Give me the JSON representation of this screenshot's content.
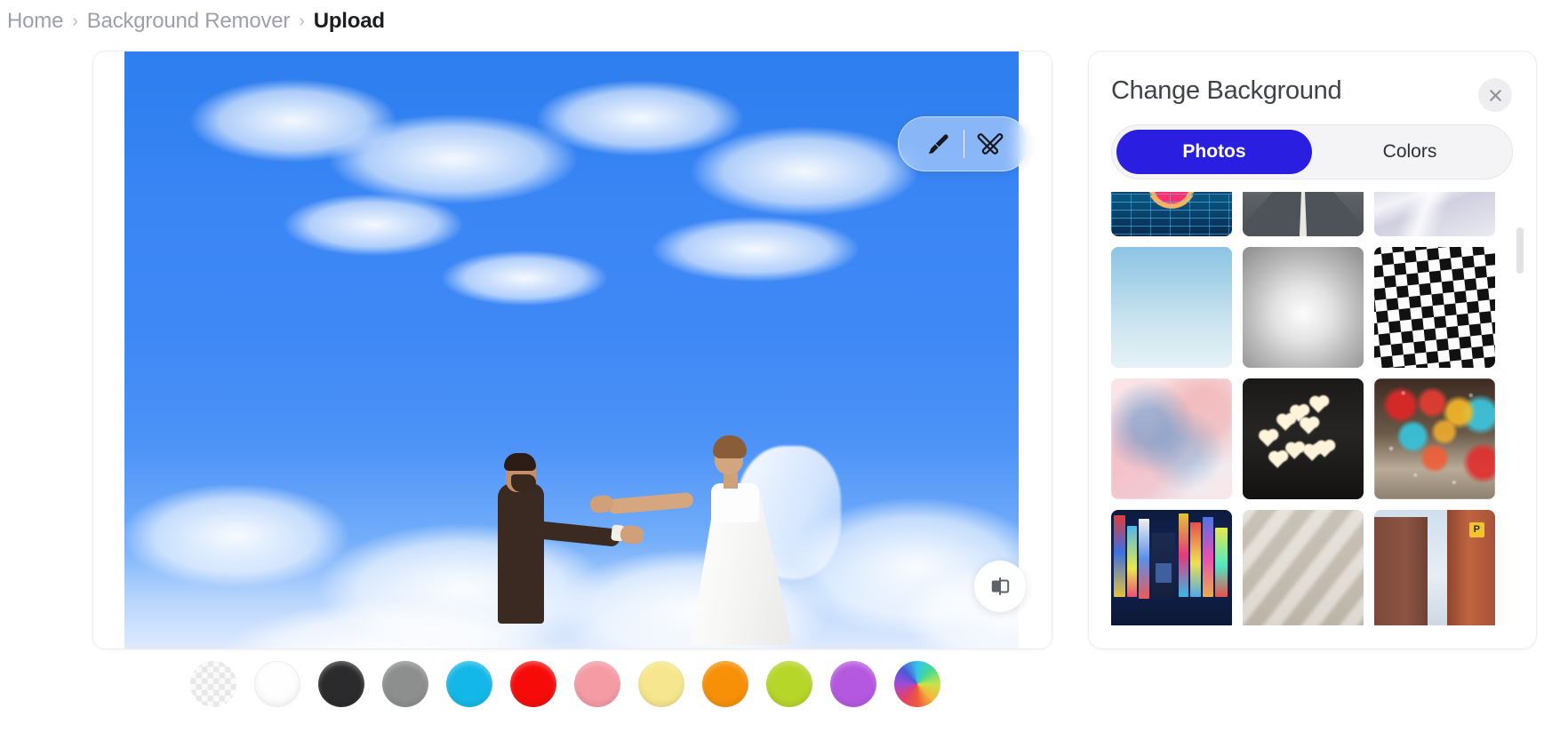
{
  "breadcrumb": {
    "items": [
      {
        "label": "Home",
        "current": false
      },
      {
        "label": "Background Remover",
        "current": false
      },
      {
        "label": "Upload",
        "current": true
      }
    ],
    "separator": "›"
  },
  "editor": {
    "photo_description": "Wedding couple holding hands against a blue sky with white clouds",
    "toolbar": {
      "brush_tool": "brush-tool",
      "erase_restore_tool": "magic-erase-tool"
    },
    "compare_button_label": "compare-before-after"
  },
  "panel": {
    "title": "Change Background",
    "close_label": "×",
    "tabs": [
      {
        "label": "Photos",
        "active": true
      },
      {
        "label": "Colors",
        "active": false
      }
    ],
    "thumbnails": [
      {
        "name": "synthwave-retro-grid",
        "style": "t-synthwave"
      },
      {
        "name": "desert-highway-road",
        "style": "t-road"
      },
      {
        "name": "white-silk-fabric",
        "style": "t-fabric"
      },
      {
        "name": "clear-blue-sky-gradient",
        "style": "t-bluesky"
      },
      {
        "name": "gray-radial-gradient",
        "style": "t-graygrad"
      },
      {
        "name": "warped-checkerboard",
        "style": "t-checker"
      },
      {
        "name": "pink-blue-watercolor-clouds",
        "style": "t-watercolor"
      },
      {
        "name": "heart-shaped-bokeh-night",
        "style": "t-hearts"
      },
      {
        "name": "colorful-bokeh-rainy-window",
        "style": "t-bokeh"
      },
      {
        "name": "tokyo-neon-street",
        "style": "t-tokyo"
      },
      {
        "name": "beige-wall-diagonal-shadows",
        "style": "t-wall"
      },
      {
        "name": "brick-buildings-parking-sign",
        "style": "t-brick"
      }
    ],
    "brick_sign_text": "P"
  },
  "swatches": [
    {
      "name": "transparent",
      "color": "transparent",
      "kind": "transparent"
    },
    {
      "name": "white",
      "color": "#ffffff",
      "kind": "white"
    },
    {
      "name": "charcoal",
      "color": "#2b2b2d",
      "kind": "solid"
    },
    {
      "name": "gray",
      "color": "#8d8f8e",
      "kind": "solid"
    },
    {
      "name": "cyan",
      "color": "#14b8e8",
      "kind": "solid"
    },
    {
      "name": "red",
      "color": "#f60b09",
      "kind": "solid"
    },
    {
      "name": "pink",
      "color": "#f59ba4",
      "kind": "solid"
    },
    {
      "name": "light-yellow",
      "color": "#f6e78e",
      "kind": "solid"
    },
    {
      "name": "orange",
      "color": "#f79007",
      "kind": "solid"
    },
    {
      "name": "yellow-green",
      "color": "#b7d62a",
      "kind": "solid"
    },
    {
      "name": "purple",
      "color": "#b558e0",
      "kind": "solid"
    },
    {
      "name": "color-picker",
      "color": "rainbow",
      "kind": "rainbow"
    }
  ],
  "colors": {
    "accent_blue": "#2a1fe0",
    "breadcrumb_muted": "#9ca0ab",
    "breadcrumb_current": "#1b1d21",
    "panel_title": "#3e4249"
  }
}
